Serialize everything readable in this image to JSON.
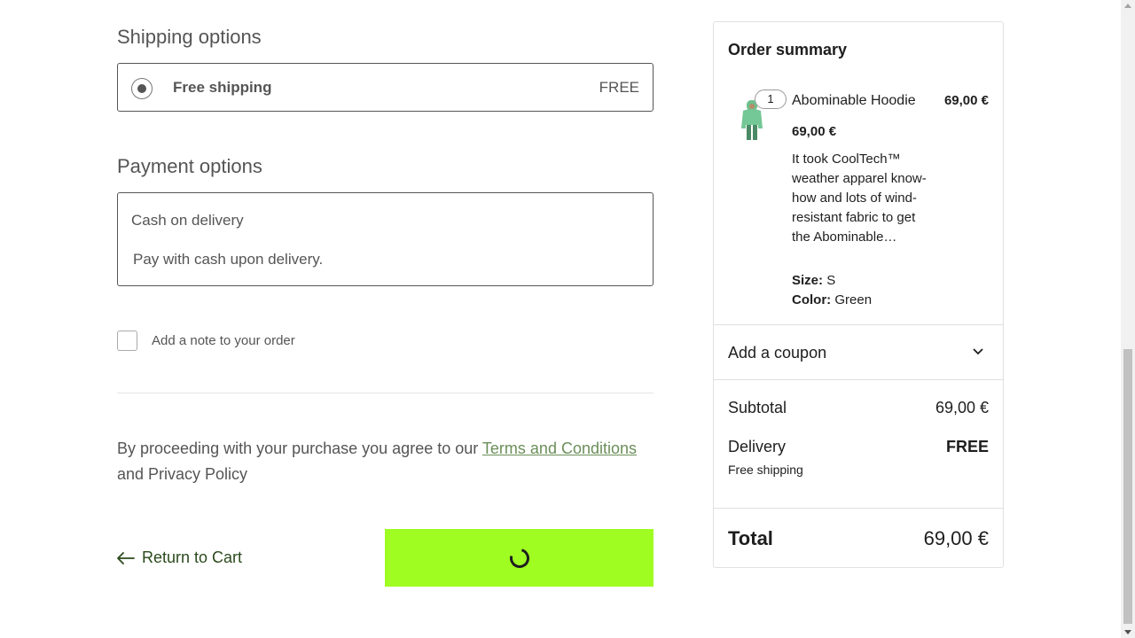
{
  "shipping": {
    "title": "Shipping options",
    "option_label": "Free shipping",
    "option_price": "FREE"
  },
  "payment": {
    "title": "Payment options",
    "method": "Cash on delivery",
    "description": "Pay with cash upon delivery."
  },
  "note": {
    "label": "Add a note to your order"
  },
  "terms": {
    "prefix": "By proceeding with your purchase you agree to our ",
    "link": "Terms and Conditions",
    "suffix": "and Privacy Policy"
  },
  "actions": {
    "return_label": "Return to Cart",
    "place_order_state": "loading"
  },
  "summary": {
    "title": "Order summary",
    "item": {
      "quantity": "1",
      "name": "Abominable Hoodie",
      "line_price": "69,00 €",
      "unit_price": "69,00 €",
      "description": "It took CoolTech™ weather apparel know-how and lots of wind-resistant fabric to get the Abominable…",
      "size_label": "Size:",
      "size_value": "S",
      "color_label": "Color:",
      "color_value": "Green"
    },
    "coupon_label": "Add a coupon",
    "subtotal_label": "Subtotal",
    "subtotal_value": "69,00 €",
    "delivery_label": "Delivery",
    "delivery_value": "FREE",
    "delivery_method": "Free shipping",
    "total_label": "Total",
    "total_value": "69,00 €"
  },
  "colors": {
    "button_accent": "#9ffd22",
    "link_green": "#6b8f5a",
    "return_link": "#2b4a1d"
  },
  "icons": {
    "return": "arrow-left-icon",
    "coupon_toggle": "chevron-down-icon",
    "loading": "spinner-icon"
  }
}
